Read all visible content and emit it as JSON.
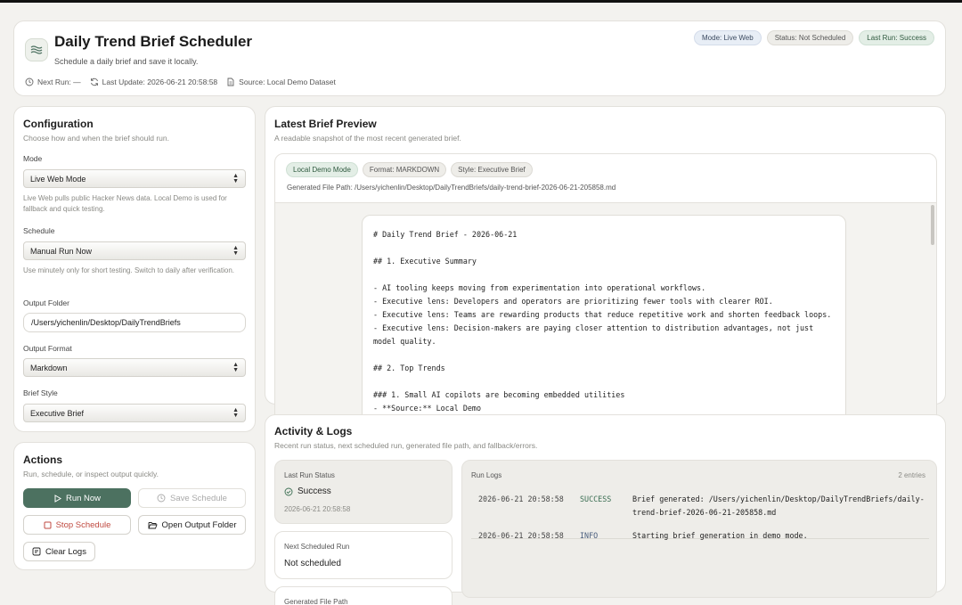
{
  "header": {
    "title": "Daily Trend Brief Scheduler",
    "subtitle": "Schedule a daily brief and save it locally.",
    "next_run": "Next Run: —",
    "last_update": "Last Update: 2026-06-21 20:58:58",
    "source": "Source: Local Demo Dataset",
    "badges": {
      "mode": "Mode: Live Web",
      "status": "Status: Not Scheduled",
      "last_run": "Last Run: Success"
    }
  },
  "config": {
    "title": "Configuration",
    "subtitle": "Choose how and when the brief should run.",
    "mode_label": "Mode",
    "mode_value": "Live Web Mode",
    "mode_help": "Live Web pulls public Hacker News data. Local Demo is used for fallback and quick testing.",
    "schedule_label": "Schedule",
    "schedule_value": "Manual Run Now",
    "schedule_help": "Use minutely only for short testing. Switch to daily after verification.",
    "folder_label": "Output Folder",
    "folder_value": "/Users/yichenlin/Desktop/DailyTrendBriefs",
    "format_label": "Output Format",
    "format_value": "Markdown",
    "style_label": "Brief Style",
    "style_value": "Executive Brief"
  },
  "actions": {
    "title": "Actions",
    "subtitle": "Run, schedule, or inspect output quickly.",
    "run_now": "Run Now",
    "save_schedule": "Save Schedule",
    "stop_schedule": "Stop Schedule",
    "open_folder": "Open Output Folder",
    "clear_logs": "Clear Logs"
  },
  "preview": {
    "title": "Latest Brief Preview",
    "subtitle": "A readable snapshot of the most recent generated brief.",
    "chips": [
      "Local Demo Mode",
      "Format: MARKDOWN",
      "Style: Executive Brief"
    ],
    "file_path": "Generated File Path: /Users/yichenlin/Desktop/DailyTrendBriefs/daily-trend-brief-2026-06-21-205858.md",
    "doc": {
      "l1": "# Daily Trend Brief - 2026-06-21",
      "l2": "## 1. Executive Summary",
      "l3": "- AI tooling keeps moving from experimentation into operational workflows.",
      "l4": "- Executive lens: Developers and operators are prioritizing fewer tools with clearer ROI.",
      "l5": "- Executive lens: Teams are rewarding products that reduce repetitive work and shorten feedback loops.",
      "l6": "- Executive lens: Decision-makers are paying closer attention to distribution advantages, not just model quality.",
      "l7": "## 2. Top Trends",
      "l8": "### 1. Small AI copilots are becoming embedded utilities",
      "l9": "- **Source:** Local Demo"
    }
  },
  "activity": {
    "title": "Activity & Logs",
    "subtitle": "Recent run status, next scheduled run, generated file path, and fallback/errors.",
    "last_run_label": "Last Run Status",
    "last_run_value": "Success",
    "last_run_time": "2026-06-21 20:58:58",
    "next_label": "Next Scheduled Run",
    "next_value": "Not scheduled",
    "path_label": "Generated File Path",
    "logs_title": "Run Logs",
    "logs_count": "2 entries",
    "logs": [
      {
        "time": "2026-06-21 20:58:58",
        "level": "SUCCESS",
        "message": "Brief generated: /Users/yichenlin/Desktop/DailyTrendBriefs/daily-trend-brief-2026-06-21-205858.md"
      },
      {
        "time": "2026-06-21 20:58:58",
        "level": "INFO",
        "message": "Starting brief generation in demo mode."
      }
    ]
  },
  "colors": {
    "accent": "#4c7160",
    "danger": "#c04a40",
    "background": "#f3f2ef"
  }
}
